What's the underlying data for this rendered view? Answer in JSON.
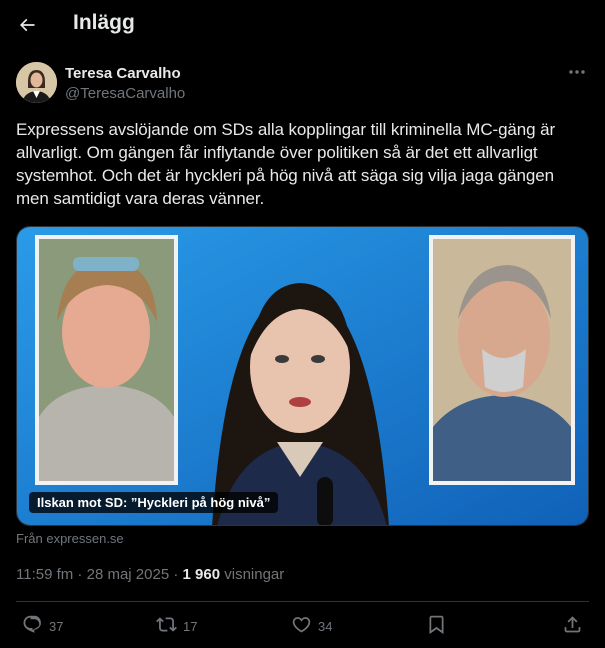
{
  "header": {
    "title": "Inlägg"
  },
  "author": {
    "name": "Teresa Carvalho",
    "handle": "@TeresaCarvalho"
  },
  "tweet": {
    "text": "Expressens avslöjande om SDs alla kopplingar till kriminella MC-gäng är allvarligt. Om gängen får inflytande över politiken så är det ett allvarligt systemhot. Och det är hyckleri på hög nivå att säga sig vilja jaga gängen men samtidigt vara deras vänner."
  },
  "card": {
    "caption": "Ilskan mot SD: ”Hyckleri på hög nivå”",
    "source": "Från expressen.se"
  },
  "meta": {
    "time": "11:59 fm",
    "separator": " · ",
    "date": "28 maj 2025",
    "views_count": "1 960",
    "views_label": " visningar"
  },
  "actions": {
    "replies": "37",
    "reposts": "17",
    "likes": "34"
  },
  "icons": {
    "back": "arrow-left-icon",
    "more": "more-horizontal-icon",
    "reply": "reply-icon",
    "repost": "repost-icon",
    "like": "heart-icon",
    "bookmark": "bookmark-icon",
    "share": "share-icon"
  },
  "colors": {
    "background": "#000000",
    "text": "#e7e9ea",
    "muted": "#71767b",
    "border": "#2f3336",
    "card_bg": "#1e88d8"
  }
}
